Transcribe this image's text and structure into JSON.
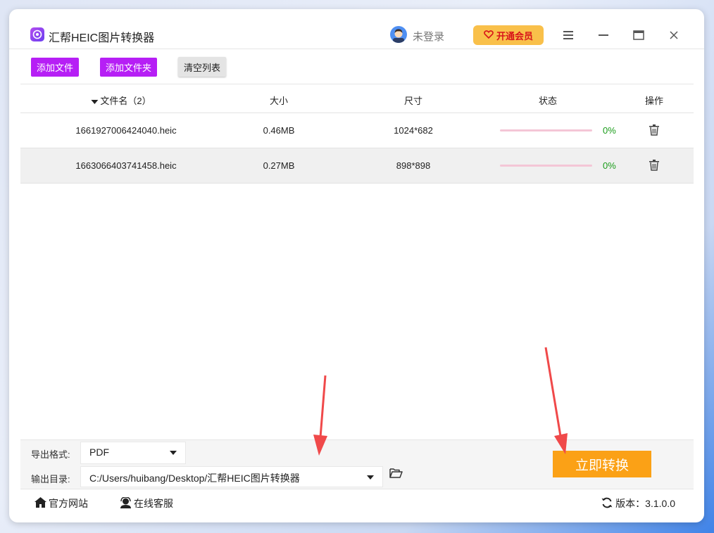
{
  "window": {
    "title": "汇帮HEIC图片转换器",
    "user_status": "未登录",
    "vip_label": "开通会员"
  },
  "toolbar": {
    "add_file": "添加文件",
    "add_folder": "添加文件夹",
    "clear_list": "清空列表"
  },
  "table": {
    "headers": {
      "filename": "文件名（2）",
      "size": "大小",
      "dimensions": "尺寸",
      "status": "状态",
      "actions": "操作"
    },
    "rows": [
      {
        "filename": "1661927006424040.heic",
        "size": "0.46MB",
        "dimensions": "1024*682",
        "progress": 0,
        "percent": "0%"
      },
      {
        "filename": "1663066403741458.heic",
        "size": "0.27MB",
        "dimensions": "898*898",
        "progress": 0,
        "percent": "0%"
      }
    ]
  },
  "settings": {
    "format_label": "导出格式:",
    "format_value": "PDF",
    "dir_label": "输出目录:",
    "dir_value": "C:/Users/huibang/Desktop/汇帮HEIC图片转换器",
    "convert_label": "立即转换"
  },
  "footer": {
    "website": "官方网站",
    "support": "在线客服",
    "version": "版本：3.1.0.0"
  },
  "colors": {
    "accent_purple": "#b61ff5",
    "convert_orange": "#fba116",
    "vip_yellow": "#f9c04a",
    "percent_green": "#1a9c1a",
    "annotation_red": "#f0494a"
  }
}
